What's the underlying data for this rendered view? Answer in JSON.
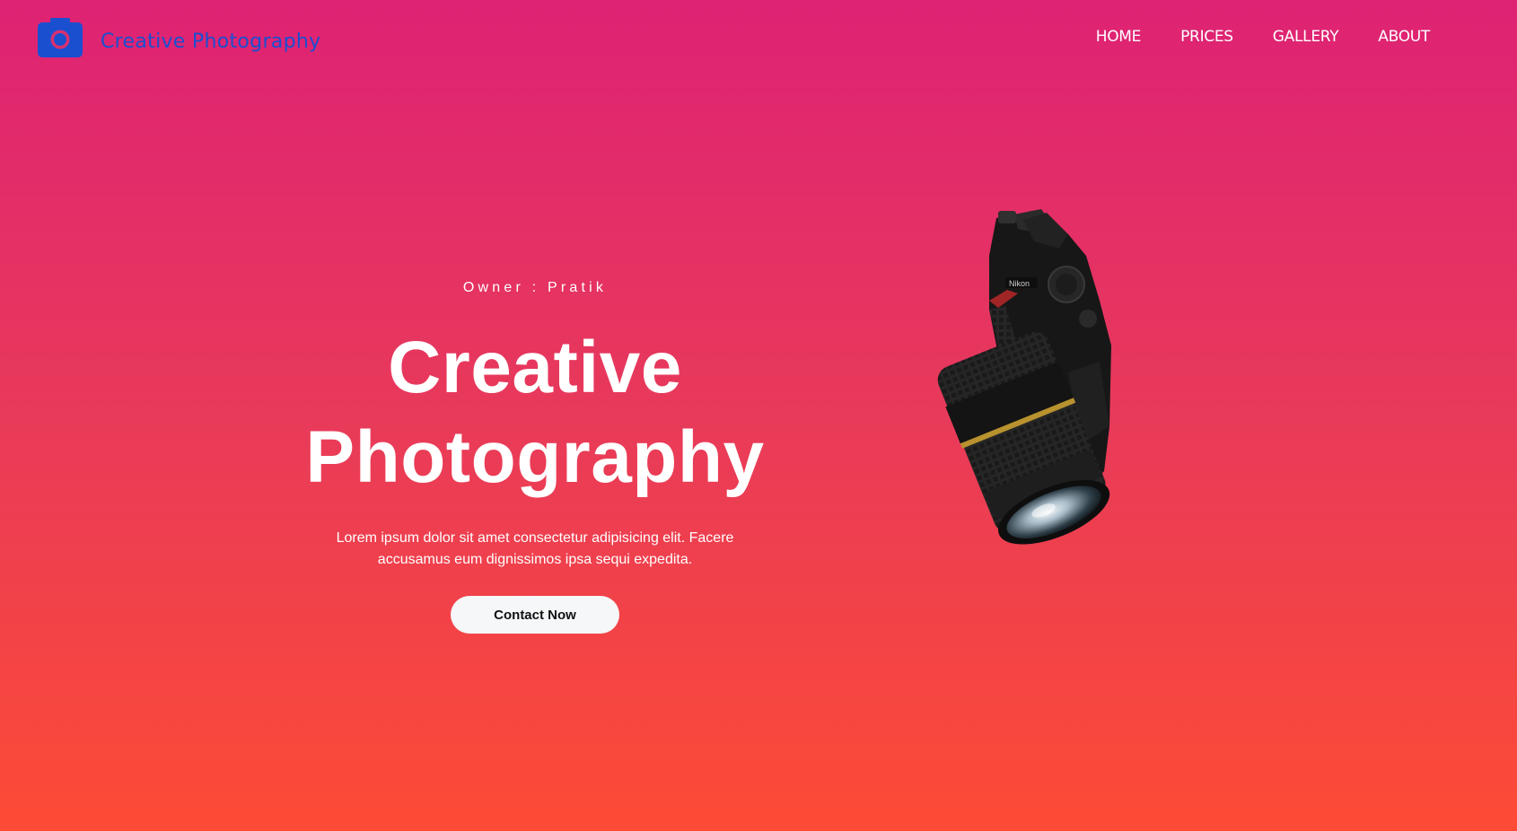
{
  "nav": {
    "brand_icon": "camera-icon",
    "brand": "Creative Photography",
    "links": [
      {
        "label": "HOME"
      },
      {
        "label": "PRICES"
      },
      {
        "label": "GALLERY"
      },
      {
        "label": "ABOUT"
      }
    ]
  },
  "hero": {
    "owner": "Owner : Pratik",
    "title_line1": "Creative",
    "title_line2": "Photography",
    "description": "Lorem ipsum dolor sit amet consectetur adipisicing elit. Facere accusamus eum dignissimos ipsa sequi expedita.",
    "cta": "Contact Now",
    "image": "dslr-camera-image"
  },
  "colors": {
    "gradient_top": "#de2274",
    "gradient_bottom": "#fd4b35",
    "brand": "#1a4fd0",
    "button_bg": "#f5f7f8"
  }
}
